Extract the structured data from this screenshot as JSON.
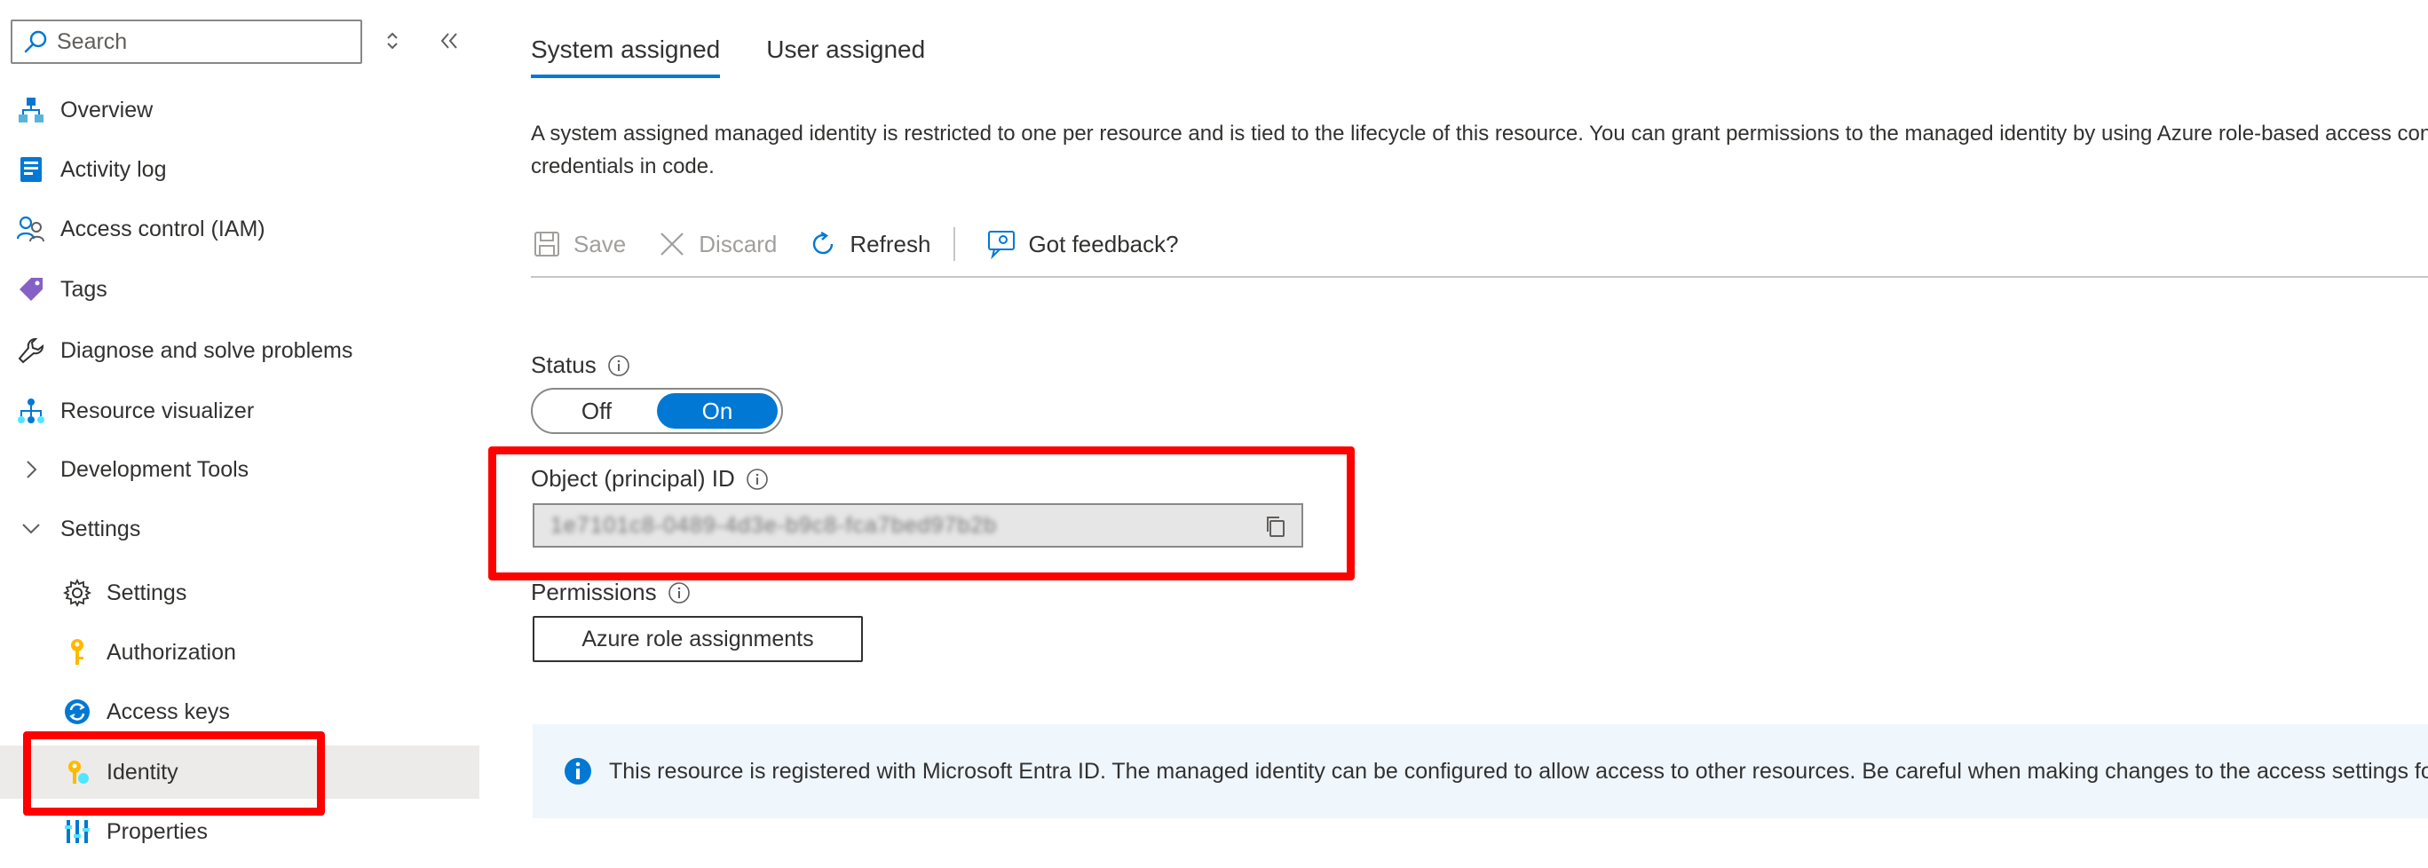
{
  "search": {
    "placeholder": "Search"
  },
  "sidebar": {
    "items": [
      {
        "label": "Overview",
        "icon": "overview-icon"
      },
      {
        "label": "Activity log",
        "icon": "activity-log-icon"
      },
      {
        "label": "Access control (IAM)",
        "icon": "people-icon"
      },
      {
        "label": "Tags",
        "icon": "tag-icon"
      },
      {
        "label": "Diagnose and solve problems",
        "icon": "wrench-icon"
      },
      {
        "label": "Resource visualizer",
        "icon": "hierarchy-icon"
      },
      {
        "label": "Development Tools",
        "icon": "chevron-right-icon"
      },
      {
        "label": "Settings",
        "icon": "chevron-down-icon"
      },
      {
        "label": "Settings",
        "icon": "gear-icon"
      },
      {
        "label": "Authorization",
        "icon": "key-icon"
      },
      {
        "label": "Access keys",
        "icon": "refresh-key-icon"
      },
      {
        "label": "Identity",
        "icon": "identity-key-icon"
      },
      {
        "label": "Properties",
        "icon": "properties-icon"
      }
    ]
  },
  "tabs": [
    {
      "label": "System assigned",
      "active": true
    },
    {
      "label": "User assigned",
      "active": false
    }
  ],
  "description": "A system assigned managed identity is restricted to one per resource and is tied to the lifecycle of this resource. You can grant permissions to the managed identity by using Azure role-based access control (Azure RBAC). The managed identity is authenticated with Microsoft Entra ID, so you don't have to store any",
  "description_line2": "credentials in code.",
  "toolbar": {
    "save": "Save",
    "discard": "Discard",
    "refresh": "Refresh",
    "feedback": "Got feedback?"
  },
  "status": {
    "label": "Status",
    "off": "Off",
    "on": "On",
    "value": "On"
  },
  "object_id": {
    "label": "Object (principal) ID",
    "value": "1e7101c8-0489-4d3e-b9c8-fca7bed97b2b"
  },
  "permissions": {
    "label": "Permissions",
    "button": "Azure role assignments"
  },
  "info_bar": {
    "text": "This resource is registered with Microsoft Entra ID. The managed identity can be configured to allow access to other resources. Be careful when making changes to the access settings for the managed identity because it can result in failures."
  },
  "colors": {
    "accent": "#0078d4",
    "highlight": "#ff0000",
    "selected_bg": "#edebe9",
    "info_bg": "#eff6fc"
  }
}
